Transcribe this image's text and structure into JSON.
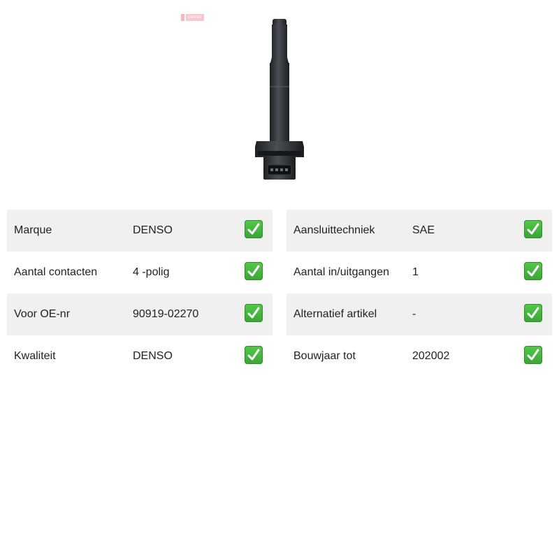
{
  "brand_logo": {
    "text": "DENSO"
  },
  "product_image": {
    "icon": "ignition-coil-image"
  },
  "specs_left": [
    {
      "label": "Marque",
      "value": "DENSO",
      "status_icon": "check-mark-icon"
    },
    {
      "label": "Aantal contacten",
      "value": "4 -polig",
      "status_icon": "check-mark-icon"
    },
    {
      "label": "Voor OE-nr",
      "value": "90919-02270",
      "status_icon": "check-mark-icon"
    },
    {
      "label": "Kwaliteit",
      "value": "DENSO",
      "status_icon": "check-mark-icon"
    }
  ],
  "specs_right": [
    {
      "label": "Aansluittechniek",
      "value": "SAE",
      "status_icon": "check-mark-icon"
    },
    {
      "label": "Aantal in/uitgangen",
      "value": "1",
      "status_icon": "check-mark-icon"
    },
    {
      "label": "Alternatief artikel",
      "value": "-",
      "status_icon": "check-mark-icon"
    },
    {
      "label": "Bouwjaar tot",
      "value": "202002",
      "status_icon": "check-mark-icon"
    }
  ],
  "colors": {
    "row_shade": "#f0f0f0",
    "check_green": "#43b33d",
    "text": "#222222"
  }
}
